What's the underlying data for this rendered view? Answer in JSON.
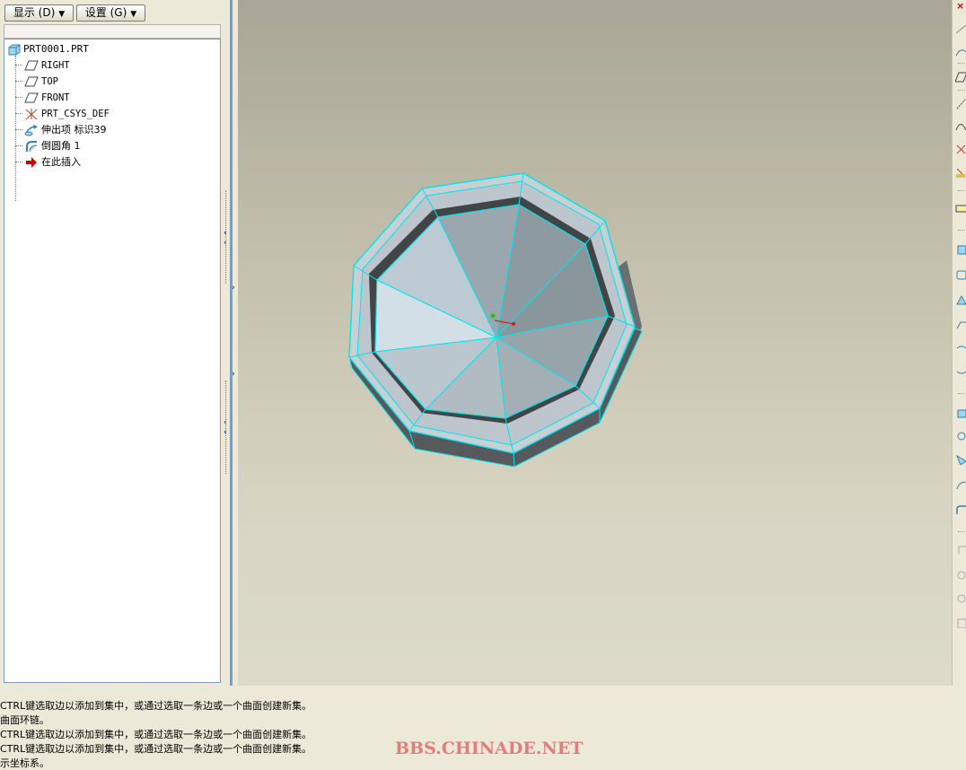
{
  "toolbar": {
    "display_label": "显示 (D)",
    "settings_label": "设置 (G)"
  },
  "model_tree": {
    "root": "PRT0001.PRT",
    "items": [
      {
        "label": "RIGHT",
        "icon": "datum-plane-icon"
      },
      {
        "label": "TOP",
        "icon": "datum-plane-icon"
      },
      {
        "label": "FRONT",
        "icon": "datum-plane-icon"
      },
      {
        "label": "PRT_CSYS_DEF",
        "icon": "coordinate-system-icon"
      },
      {
        "label": "伸出项 标识39",
        "icon": "extrude-icon"
      },
      {
        "label": "倒圆角 1",
        "icon": "round-icon"
      },
      {
        "label": "在此插入",
        "icon": "insert-here-arrow-icon"
      }
    ]
  },
  "messages": [
    "CTRL键选取边以添加到集中，或通过选取一条边或一个曲面创建新集。",
    "曲面环链。",
    "CTRL键选取边以添加到集中，或通过选取一条边或一个曲面创建新集。",
    "CTRL键选取边以添加到集中，或通过选取一条边或一个曲面创建新集。",
    "示坐标系。"
  ],
  "watermark": "BBS.CHINADE.NET",
  "colors": {
    "highlight_edge": "#00e5ee",
    "insert_arrow": "#cc0000",
    "watermark": "#e47c7c"
  }
}
